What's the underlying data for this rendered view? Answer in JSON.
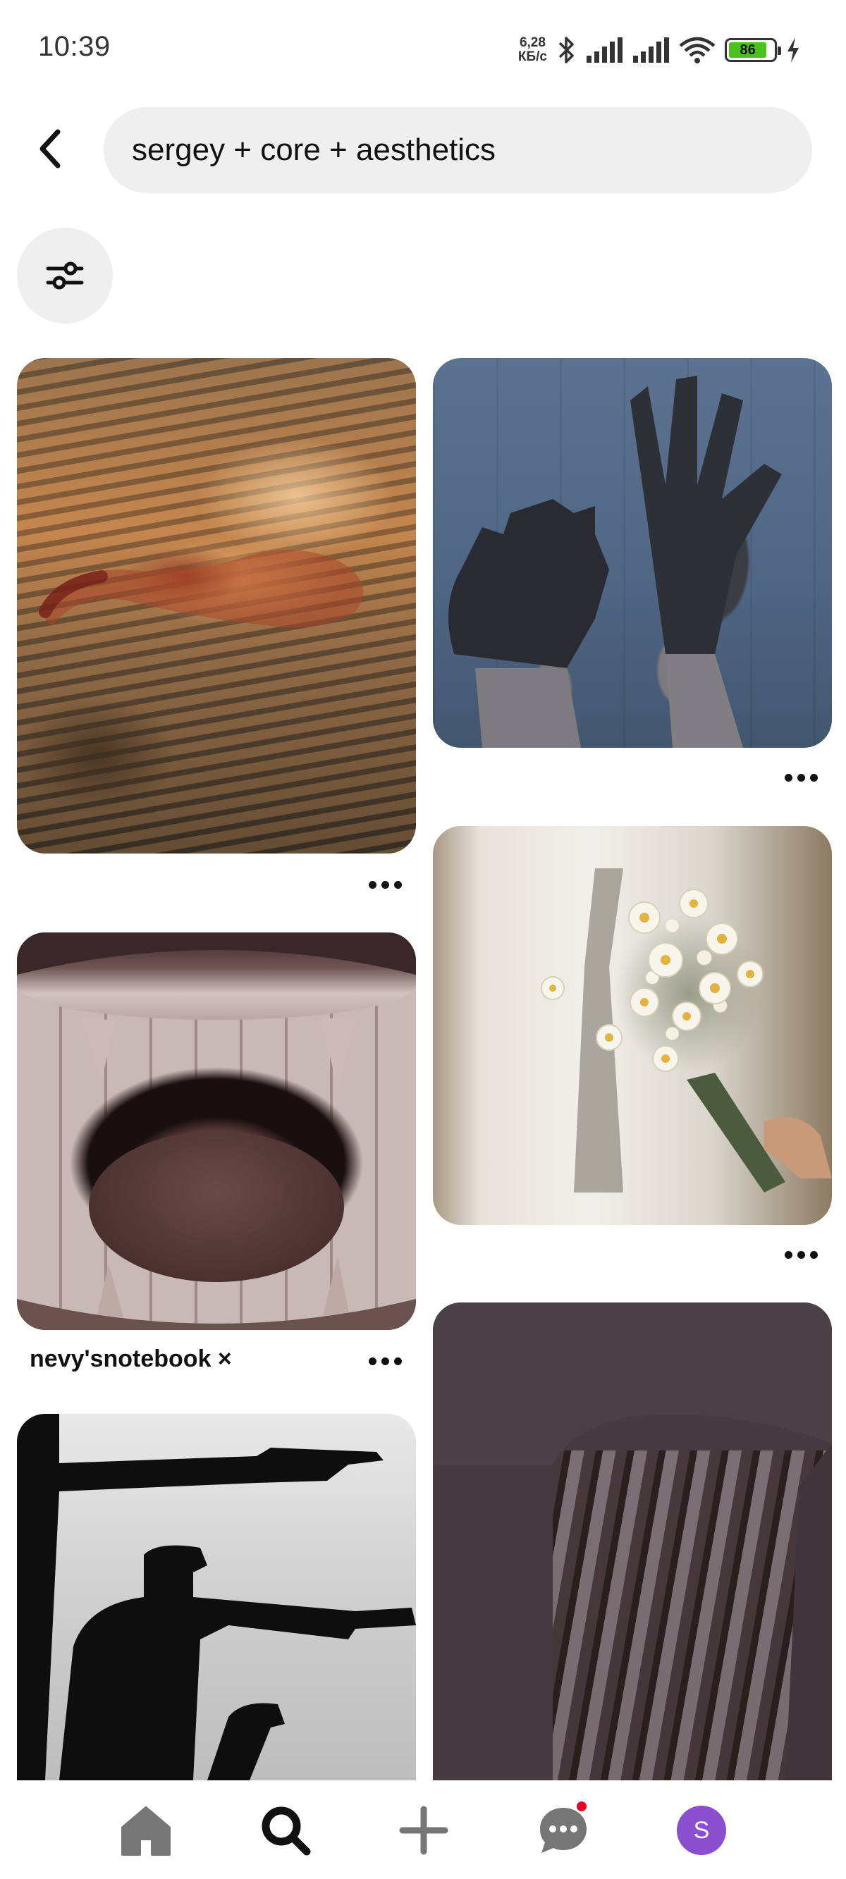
{
  "status_bar": {
    "time": "10:39",
    "net_speed_value": "6,28",
    "net_speed_unit": "КБ/с",
    "battery_level": "86",
    "battery_color": "#4cc21c"
  },
  "search": {
    "query": "sergey + core + aesthetics"
  },
  "pins": [
    {
      "image": "swimmer painting in golden water",
      "title": ""
    },
    {
      "image": "hands covered in black paint",
      "title": ""
    },
    {
      "image": "person holding a bouquet of daisies",
      "title": ""
    },
    {
      "image": "open mouth with fangs",
      "title": "nevy'snotebook ×"
    },
    {
      "image": "silhouettes pointing pistols",
      "title": ""
    },
    {
      "image": "bundle of arrows in a quiver",
      "title": ""
    }
  ],
  "bottom_nav": {
    "items": [
      {
        "icon": "home-icon"
      },
      {
        "icon": "search-icon",
        "active": true
      },
      {
        "icon": "plus-icon"
      },
      {
        "icon": "chat-icon",
        "has_notification": true
      },
      {
        "icon": "profile-avatar"
      }
    ],
    "avatar_letter": "S",
    "avatar_color": "#8b4ecf",
    "notification_color": "#e60023"
  }
}
